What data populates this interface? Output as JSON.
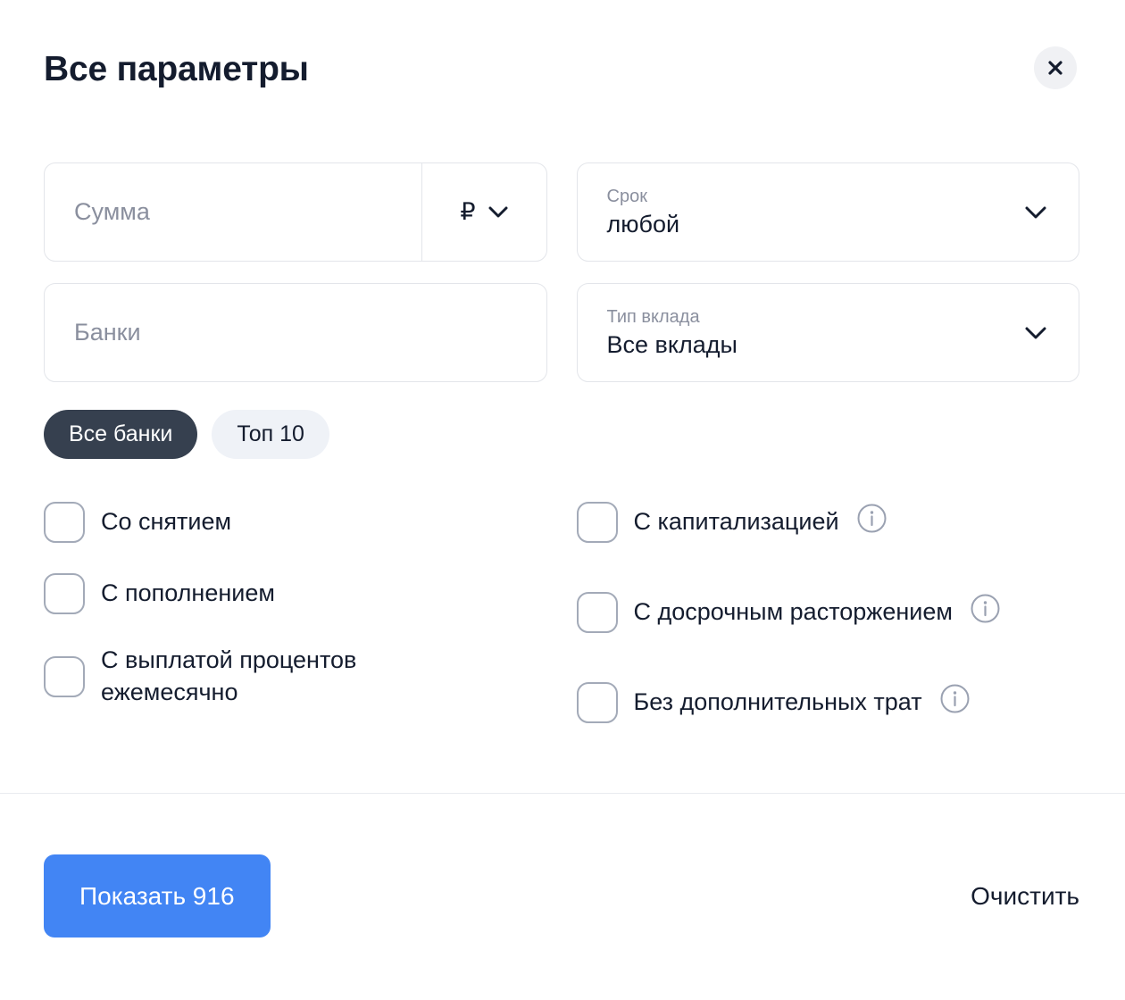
{
  "header": {
    "title": "Все параметры",
    "close_label": "×",
    "close_icon": "close-icon"
  },
  "fields": {
    "sum": {
      "placeholder": "Сумма",
      "currency_symbol": "₽",
      "currency_icon": "chevron-down-icon"
    },
    "term": {
      "label": "Срок",
      "value": "любой",
      "icon": "chevron-down-icon"
    },
    "banks": {
      "placeholder": "Банки"
    },
    "deposit_type": {
      "label": "Тип вклада",
      "value": "Все вклады",
      "icon": "chevron-down-icon"
    }
  },
  "pills": [
    {
      "label": "Все банки",
      "active": true
    },
    {
      "label": "Топ 10",
      "active": false
    }
  ],
  "checkboxes": {
    "left": [
      {
        "label": "Со снятием",
        "checked": false,
        "info": false
      },
      {
        "label": "С пополнением",
        "checked": false,
        "info": false
      },
      {
        "label": "С выплатой процентов ежемесячно",
        "checked": false,
        "info": false
      }
    ],
    "right": [
      {
        "label": "С капитализацией",
        "checked": false,
        "info": true,
        "info_icon": "info-icon"
      },
      {
        "label": "С досрочным расторжением",
        "checked": false,
        "info": true,
        "info_icon": "info-icon"
      },
      {
        "label": "Без дополнительных трат",
        "checked": false,
        "info": true,
        "info_icon": "info-icon"
      }
    ]
  },
  "footer": {
    "submit_label": "Показать 916",
    "clear_label": "Очистить"
  },
  "colors": {
    "accent": "#4285f4",
    "pill_active_bg": "#36404f",
    "pill_inactive_bg": "#eff2f7",
    "text_primary": "#141c2e",
    "text_muted": "#8a8f9e",
    "border": "#e3e5ea",
    "checkbox_border": "#a3aab8"
  }
}
